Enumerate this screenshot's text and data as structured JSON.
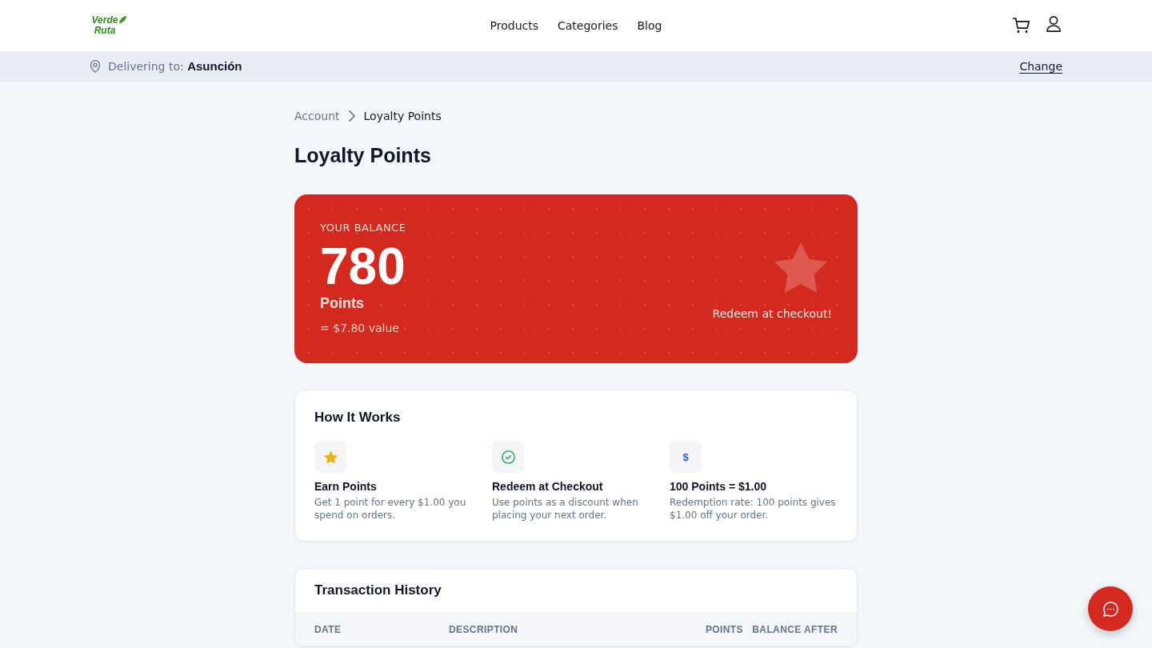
{
  "header": {
    "logo": "Verde Ruta",
    "nav": [
      "Products",
      "Categories",
      "Blog"
    ]
  },
  "delivery_bar": {
    "text": "Delivering to: **Asunción**",
    "action": "Change"
  },
  "breadcrumb": [
    {
      "label": "Account",
      "current": false
    },
    {
      "label": "Loyalty Points",
      "current": true
    }
  ],
  "page_title": "Loyalty Points",
  "balance_card": {
    "label": "YOUR BALANCE",
    "points": "780",
    "unit": "Points",
    "value": "= $7.80 value",
    "note": "Redeem at checkout!"
  },
  "how_it_works": {
    "title": "How It Works",
    "steps": [
      {
        "kind": "star",
        "title": "Earn Points",
        "text": "Get 1 point for every $1.00 you spend on orders."
      },
      {
        "kind": "check",
        "title": "Redeem at Checkout",
        "text": "Use points as a discount when placing your next order."
      },
      {
        "kind": "symbol",
        "symbol": "$",
        "title": "100 Points = $1.00",
        "text": "Redemption rate: 100 points gives $1.00 off your order."
      }
    ]
  },
  "transaction_history": {
    "title": "Transaction History",
    "columns": [
      {
        "label": "DATE",
        "numeric": false
      },
      {
        "label": "DESCRIPTION",
        "numeric": false
      },
      {
        "label": "POINTS",
        "numeric": true
      },
      {
        "label": "BALANCE AFTER",
        "numeric": true
      }
    ]
  }
}
